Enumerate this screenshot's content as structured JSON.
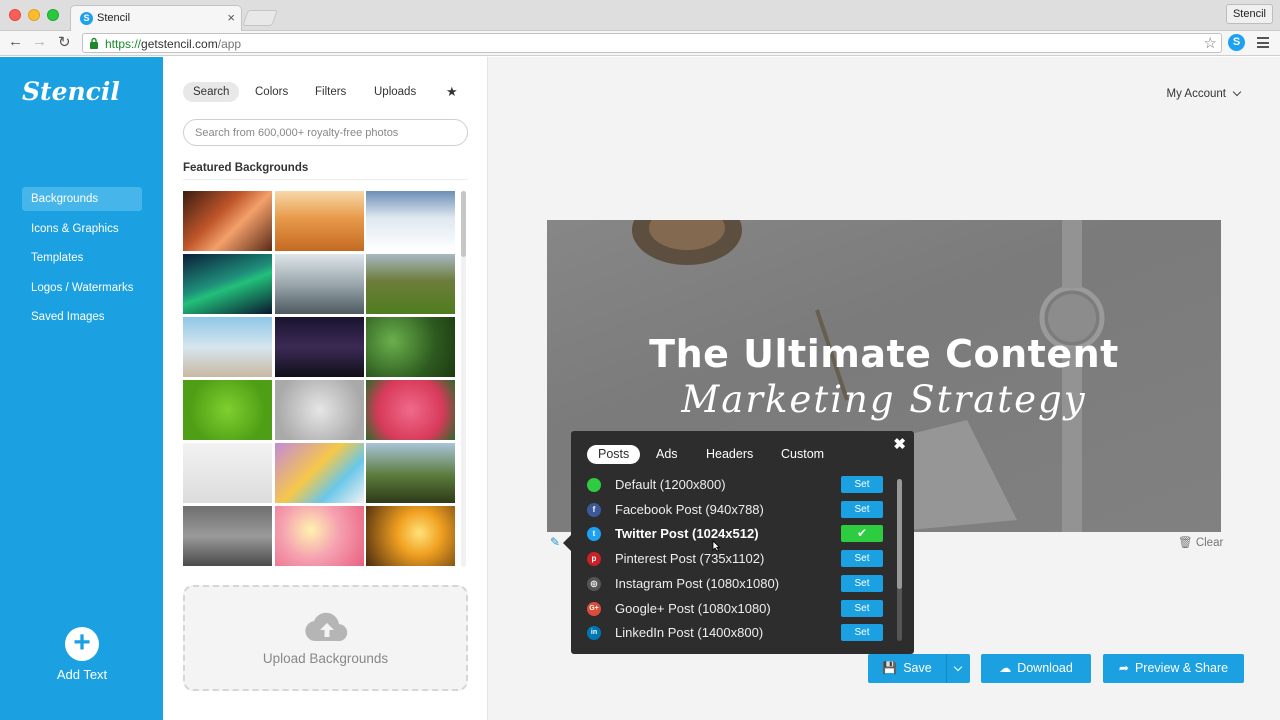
{
  "browser": {
    "tab_title": "Stencil",
    "tab_close": "×",
    "profile_name": "Stencil",
    "url_protocol": "https://",
    "url_host": "getstencil.com",
    "url_path": "/app",
    "ext_icon_glyph": "S"
  },
  "app": {
    "logo": "Stencil",
    "accent": "#1ba1e2"
  },
  "sidebar": {
    "items": [
      {
        "label": "Backgrounds",
        "active": true
      },
      {
        "label": "Icons & Graphics"
      },
      {
        "label": "Templates"
      },
      {
        "label": "Logos / Watermarks"
      },
      {
        "label": "Saved Images"
      }
    ],
    "add_text_label": "Add Text",
    "add_icon_glyph": "+"
  },
  "panel": {
    "tabs": [
      "Search",
      "Colors",
      "Filters",
      "Uploads"
    ],
    "favorites_icon": "star-icon",
    "search_placeholder": "Search from 600,000+ royalty-free photos",
    "featured_title": "Featured Backgrounds",
    "thumbnails": [
      "orange-slot-canyon",
      "desert-dunes",
      "snowy-trees",
      "aurora-borealis",
      "mountain-balloon",
      "green-hills",
      "wooden-pier",
      "night-bridge",
      "ivy-leaves",
      "green-grass",
      "stone-flower",
      "pink-flowers",
      "blank-card",
      "gift-boxes",
      "tree-cliff",
      "candle-wood",
      "rose-petals",
      "sunset-silhouette"
    ],
    "upload_label": "Upload Backgrounds"
  },
  "workspace": {
    "account_label": "My Account",
    "canvas_headline": "The Ultimate Content",
    "canvas_subline": "Marketing  Strategy",
    "clear_label": "Clear",
    "clear_icon": "trash-icon"
  },
  "size_picker": {
    "close_glyph": "✖",
    "tabs": [
      {
        "label": "Posts",
        "active": true
      },
      {
        "label": "Ads"
      },
      {
        "label": "Headers"
      },
      {
        "label": "Custom"
      }
    ],
    "sizes": [
      {
        "label": "Default (1200x800)",
        "icon": "green-dot-icon",
        "icon_glyph": "",
        "icon_color": "#2ecc40",
        "button": "Set"
      },
      {
        "label": "Facebook Post (940x788)",
        "icon": "facebook-icon",
        "icon_glyph": "f",
        "icon_color": "#3b5998",
        "button": "Set"
      },
      {
        "label": "Twitter Post (1024x512)",
        "icon": "twitter-icon",
        "icon_glyph": "t",
        "icon_color": "#1da1f2",
        "button": "✔",
        "selected": true
      },
      {
        "label": "Pinterest Post (735x1102)",
        "icon": "pinterest-icon",
        "icon_glyph": "p",
        "icon_color": "#cb2027",
        "button": "Set"
      },
      {
        "label": "Instagram Post (1080x1080)",
        "icon": "instagram-icon",
        "icon_glyph": "◎",
        "icon_color": "#555555",
        "button": "Set"
      },
      {
        "label": "Google+ Post (1080x1080)",
        "icon": "google-plus-icon",
        "icon_glyph": "G+",
        "icon_color": "#dd4b39",
        "button": "Set"
      },
      {
        "label": "LinkedIn Post (1400x800)",
        "icon": "linkedin-icon",
        "icon_glyph": "in",
        "icon_color": "#0077b5",
        "button": "Set"
      }
    ]
  },
  "actions": {
    "save_label": "Save",
    "download_label": "Download",
    "preview_label": "Preview & Share"
  }
}
